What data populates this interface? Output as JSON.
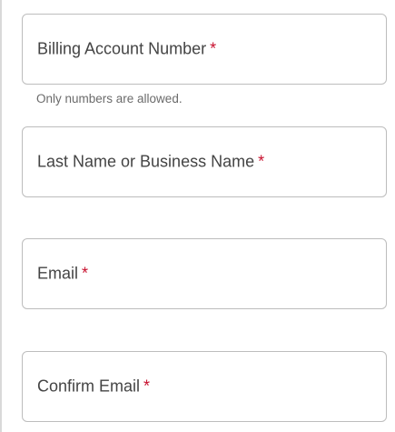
{
  "form": {
    "fields": [
      {
        "label": "Billing Account Number",
        "required_marker": "*",
        "value": ""
      },
      {
        "label": "Last Name or Business Name",
        "required_marker": "*",
        "value": ""
      },
      {
        "label": "Email",
        "required_marker": "*",
        "value": ""
      },
      {
        "label": "Confirm Email",
        "required_marker": "*",
        "value": ""
      }
    ],
    "billing_hint": "Only numbers are allowed."
  },
  "colors": {
    "required": "#c8102e",
    "border": "#bdbdbd",
    "label": "#444444",
    "hint": "#6b6b6b"
  }
}
